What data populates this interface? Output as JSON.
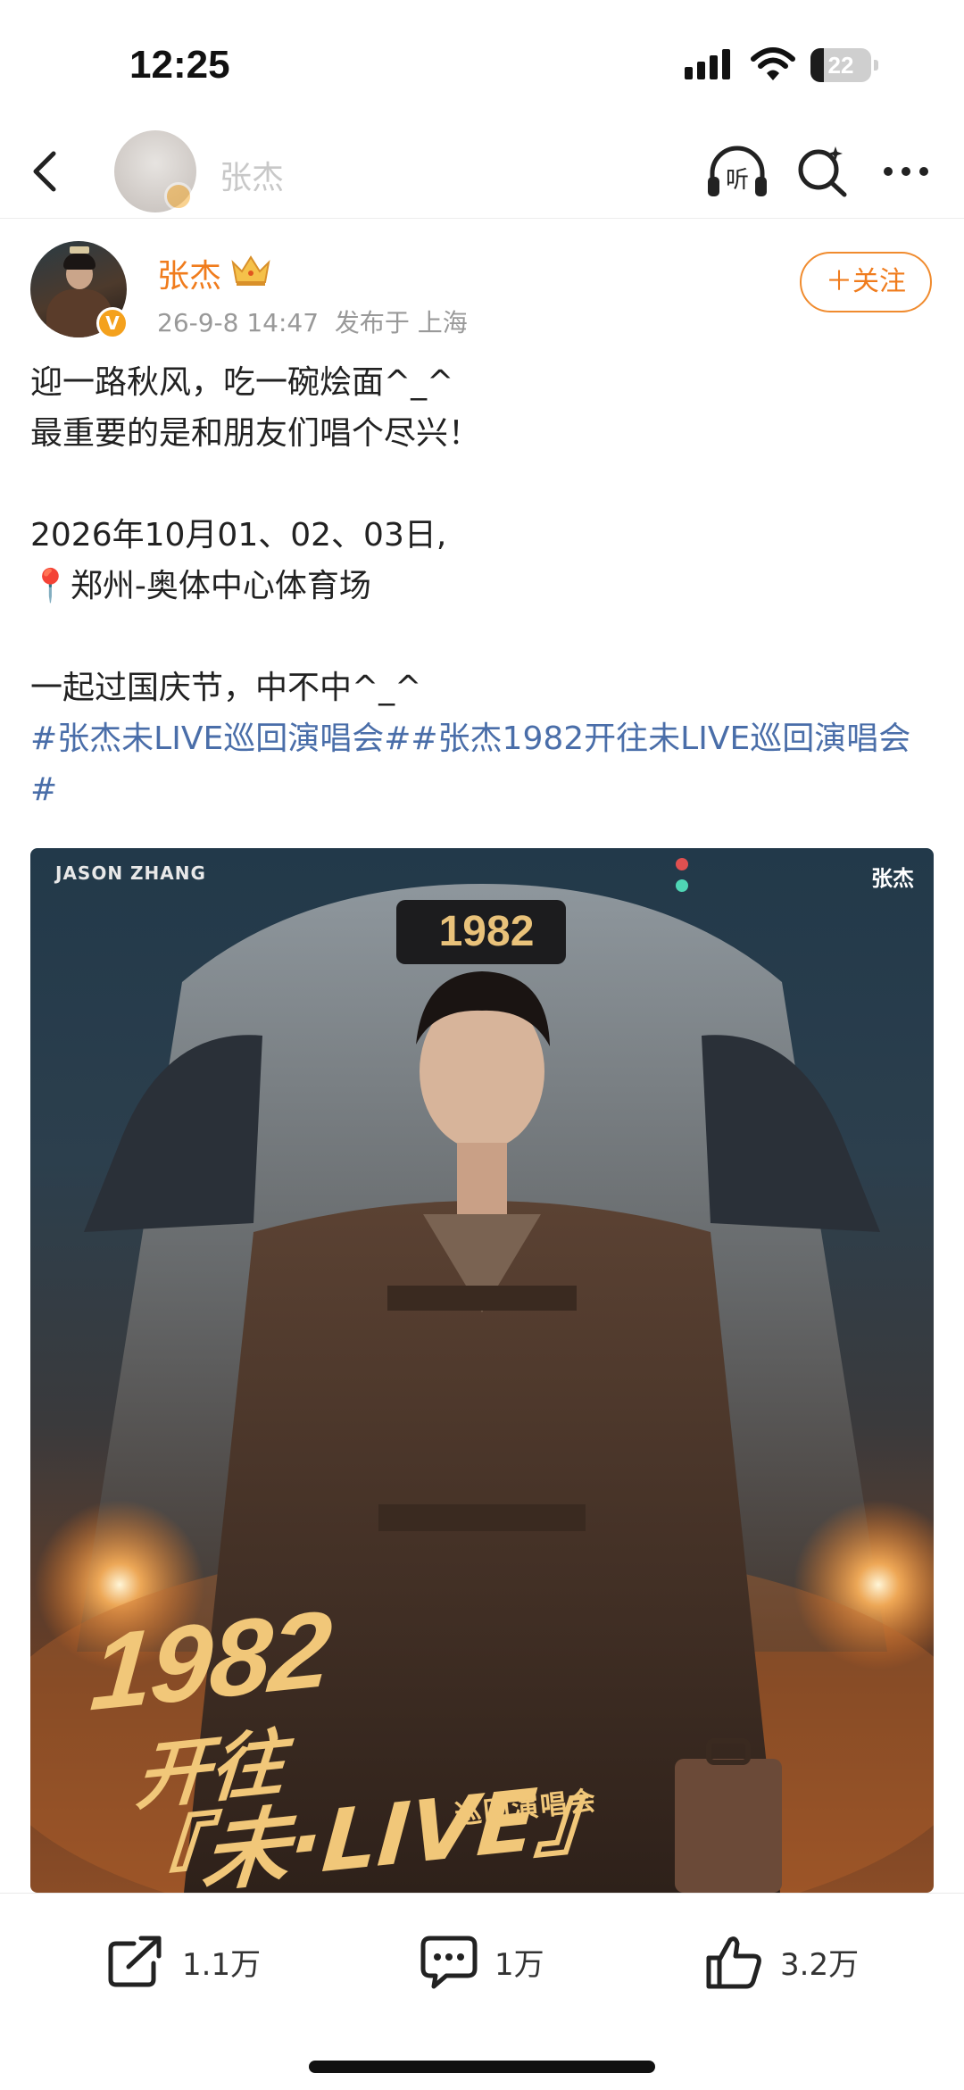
{
  "status_bar": {
    "time": "12:25",
    "battery": "22",
    "battery_level": 0.22
  },
  "nav": {
    "title": "张杰",
    "back_icon": "chevron-left-icon",
    "listen_icon": "headphones-listen-icon",
    "listen_label": "听",
    "search_icon": "search-sparkle-icon",
    "more_icon": "more-dots-icon"
  },
  "post": {
    "author": "张杰",
    "verified_mark": "V",
    "meta": "26-9-8 14:47  发布于 上海",
    "follow_label": "＋关注",
    "lines": [
      "迎一路秋风，吃一碗烩面^_^",
      "最重要的是和朋友们唱个尽兴！",
      "",
      "2026年10月01、02、03日,",
      "📍郑州-奥体中心体育场",
      "",
      "一起过国庆节，中不中^_^"
    ],
    "hashtags": "#张杰未LIVE巡回演唱会##张杰1982开往未LIVE巡回演唱会#"
  },
  "poster": {
    "brand_en": "JASON ZHANG",
    "brand_cn": "张杰",
    "train_number": "1982",
    "title_year": "1982",
    "title_line2": "开往",
    "title_line3": "『未·LIVE』",
    "subtitle": "巡回演唱会"
  },
  "actions": {
    "share_count": "1.1万",
    "comment_count": "1万",
    "like_count": "3.2万"
  },
  "colors": {
    "accent_orange": "#f07c1d",
    "hashtag_blue": "#4a6ea9",
    "poster_gold": "#f1c779"
  }
}
